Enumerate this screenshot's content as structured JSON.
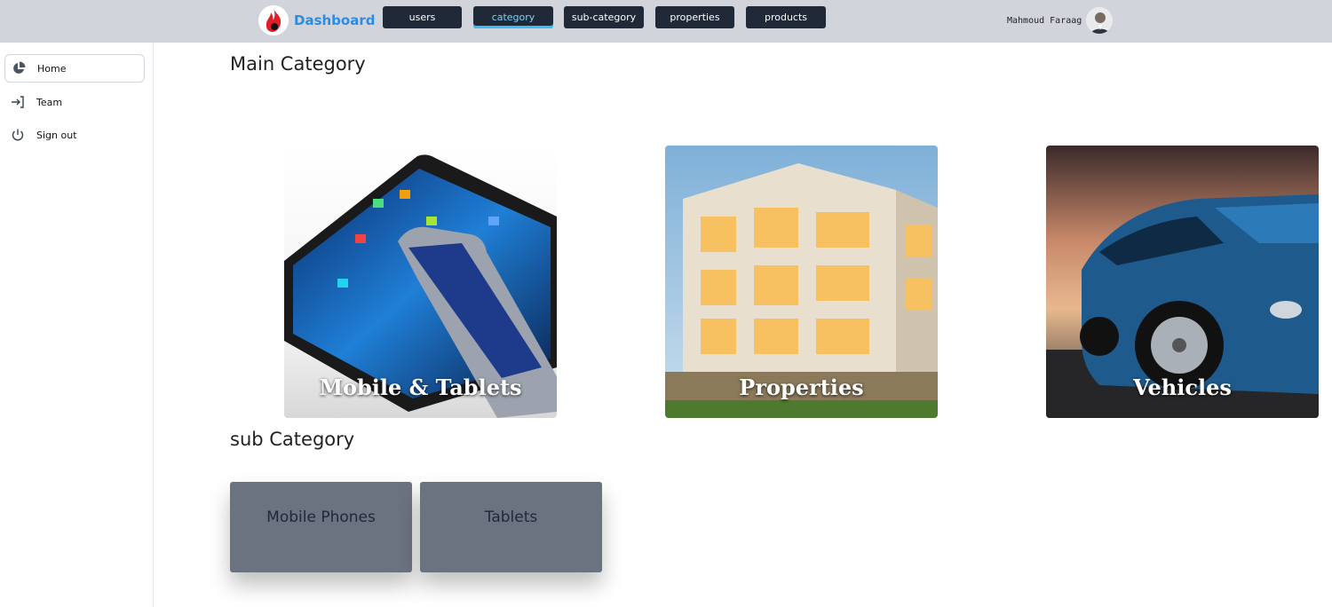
{
  "header": {
    "brand": "Dashboard",
    "nav": [
      {
        "label": "users"
      },
      {
        "label": "category",
        "active": true
      },
      {
        "label": "sub-category"
      },
      {
        "label": "properties"
      },
      {
        "label": "products"
      }
    ],
    "user_name": "Mahmoud Faraag"
  },
  "sidebar": {
    "items": [
      {
        "label": "Home",
        "icon": "pie-chart-icon",
        "active": true
      },
      {
        "label": "Team",
        "icon": "sign-in-icon"
      },
      {
        "label": "Sign out",
        "icon": "power-icon"
      }
    ]
  },
  "main": {
    "main_category_title": "Main Category",
    "categories": [
      {
        "label": "Mobile & Tablets",
        "image": "tablet-and-phone"
      },
      {
        "label": "Properties",
        "image": "apartment-building"
      },
      {
        "label": "Vehicles",
        "image": "blue-car"
      }
    ],
    "sub_category_title": "sub Category",
    "sub_categories": [
      {
        "label": "Mobile Phones"
      },
      {
        "label": "Tablets"
      }
    ]
  },
  "colors": {
    "topbar": "#d1d5db",
    "nav_button": "#1f2937",
    "brand": "#2b8ce6",
    "active_accent": "#38bdf8",
    "sub_card": "#6b7280"
  }
}
